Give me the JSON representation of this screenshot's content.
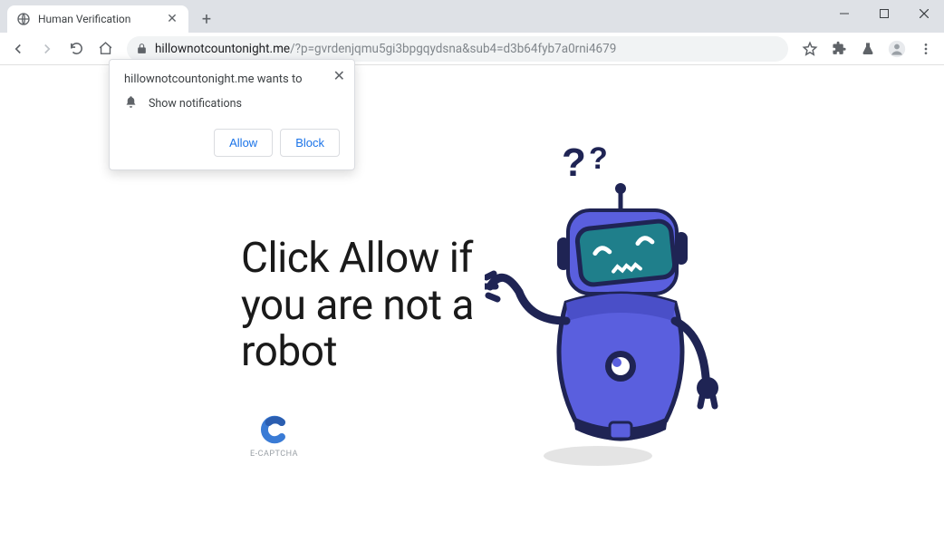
{
  "window": {
    "tab_title": "Human Verification"
  },
  "toolbar": {
    "url_host": "hillownotcountonight.me",
    "url_path": "/?p=gvrdenjqmu5gi3bpgqydsna&sub4=d3b64fyb7a0rni4679"
  },
  "permission": {
    "title": "hillownotcountonight.me wants to",
    "item": "Show notifications",
    "allow": "Allow",
    "block": "Block"
  },
  "page": {
    "heading": "Click Allow if you are not a robot",
    "captcha_label": "E-CAPTCHA"
  }
}
